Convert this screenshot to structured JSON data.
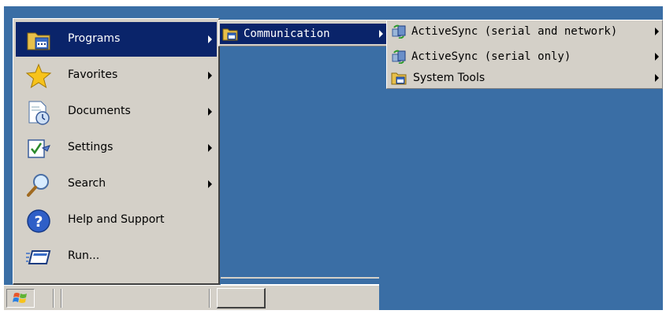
{
  "start_menu": {
    "items": [
      {
        "label": "Programs",
        "icon": "programs-folder-icon",
        "has_submenu": true,
        "selected": true
      },
      {
        "label": "Favorites",
        "icon": "favorites-star-icon",
        "has_submenu": true
      },
      {
        "label": "Documents",
        "icon": "documents-icon",
        "has_submenu": true
      },
      {
        "label": "Settings",
        "icon": "settings-icon",
        "has_submenu": true
      },
      {
        "label": "Search",
        "icon": "search-magnifier-icon",
        "has_submenu": true
      },
      {
        "label": "Help and Support",
        "icon": "help-icon",
        "has_submenu": false
      },
      {
        "label": "Run...",
        "icon": "run-icon",
        "has_submenu": false
      }
    ]
  },
  "programs_submenu": {
    "items": [
      {
        "label": "Communication",
        "icon": "program-group-icon",
        "has_submenu": true,
        "selected": true
      }
    ]
  },
  "communication_submenu": {
    "items": [
      {
        "label": "ActiveSync (serial and network)",
        "icon": "activesync-icon",
        "has_submenu": true
      },
      {
        "label": "ActiveSync (serial only)",
        "icon": "activesync-icon",
        "has_submenu": true
      },
      {
        "label": "System Tools",
        "icon": "program-group-icon",
        "has_submenu": true
      }
    ]
  },
  "taskbar": {
    "start_icon": "windows-flag-icon"
  },
  "colors": {
    "desktop": "#3a6ea5",
    "menu_face": "#d4d0c8",
    "highlight": "#0a246a"
  }
}
